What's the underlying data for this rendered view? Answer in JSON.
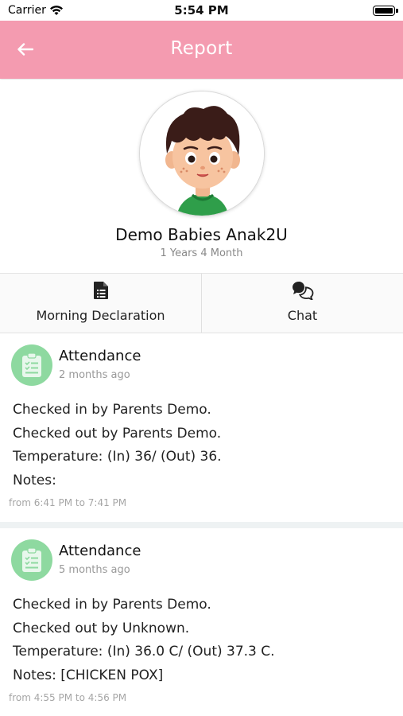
{
  "status_bar": {
    "carrier": "Carrier",
    "time": "5:54 PM"
  },
  "header": {
    "title": "Report",
    "back_icon": "arrow-left-icon"
  },
  "profile": {
    "name": "Demo Babies Anak2U",
    "age": "1 Years 4 Month"
  },
  "actions": [
    {
      "label": "Morning Declaration",
      "icon": "document-icon"
    },
    {
      "label": "Chat",
      "icon": "chat-icon"
    }
  ],
  "feed": [
    {
      "title": "Attendance",
      "time_ago": "2 months ago",
      "lines": [
        "Checked in by Parents Demo.",
        "Checked out by Parents Demo.",
        "Temperature: (In) 36/ (Out) 36.",
        "Notes:"
      ],
      "range": "from 6:41 PM to 7:41 PM"
    },
    {
      "title": "Attendance",
      "time_ago": "5 months ago",
      "lines": [
        "Checked in by Parents Demo.",
        "Checked out by Unknown.",
        "Temperature: (In) 36.0 C/ (Out) 37.3 C.",
        "Notes: [CHICKEN POX]"
      ],
      "range": "from 4:55 PM to 4:56 PM"
    }
  ],
  "colors": {
    "header": "#f49bb0",
    "attendance_icon_bg": "#8ed9a0"
  }
}
